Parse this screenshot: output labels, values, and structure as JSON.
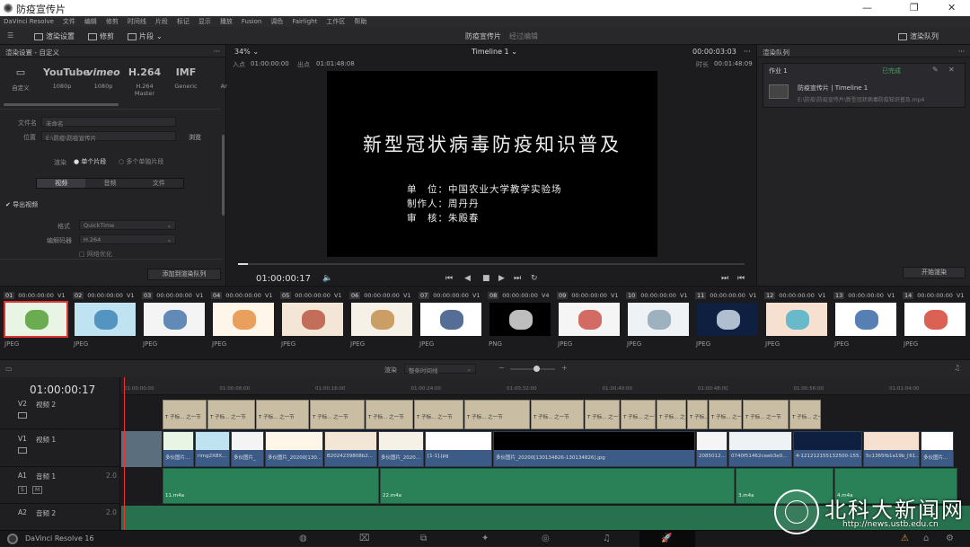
{
  "window": {
    "title": "防疫宣传片"
  },
  "menu": [
    "DaVinci Resolve",
    "文件",
    "编辑",
    "修剪",
    "时间线",
    "片段",
    "标记",
    "显示",
    "播放",
    "Fusion",
    "调色",
    "Fairlight",
    "工作区",
    "帮助"
  ],
  "toolbar": {
    "render_settings": "渲染设置",
    "clip": "修剪",
    "clip_sub": "片段",
    "project_name": "防疫宣传片",
    "edited": "经过编辑",
    "render_queue": "渲染队列"
  },
  "left_panel": {
    "title": "渲染设置 - 自定义",
    "presets": [
      {
        "big": "▭",
        "label": "自定义"
      },
      {
        "big": "YouTube",
        "label": "1080p"
      },
      {
        "big": "vimeo",
        "label": "1080p"
      },
      {
        "big": "H.264",
        "label": "H.264 Master"
      },
      {
        "big": "IMF",
        "label": "Generic"
      },
      {
        "big": "",
        "label": "Ame"
      }
    ],
    "filename_label": "文件名",
    "filename_value": "未命名",
    "location_label": "位置",
    "location_value": "E:\\防疫\\防疫宣传片",
    "browse": "浏览",
    "render_label": "渲染",
    "single_clip": "单个片段",
    "multi_clip": "多个单独片段",
    "tabs": [
      "视频",
      "音频",
      "文件"
    ],
    "export_video": "导出视频",
    "format_label": "格式",
    "format_value": "QuickTime",
    "codec_label": "编解码器",
    "codec_value": "H.264",
    "net_opt": "网络优化",
    "add_queue": "添加到渲染队列"
  },
  "viewer": {
    "zoom": "34%",
    "timeline_name": "Timeline 1",
    "tc_right": "00:00:03:03",
    "in_label": "入点",
    "in_tc": "01:00:00:00",
    "out_label": "出点",
    "out_tc": "01:01:48:08",
    "dur_label": "时长",
    "dur_tc": "00:01:48:09",
    "title": "新型冠状病毒防疫知识普及",
    "credits": [
      {
        "k": "单　位：",
        "v": "中国农业大学教学实验场"
      },
      {
        "k": "制作人：",
        "v": "周丹丹"
      },
      {
        "k": "审　核：",
        "v": "朱殿春"
      }
    ],
    "timecode": "01:00:00:17",
    "play_progress": 0.02
  },
  "right_panel": {
    "title": "渲染队列",
    "job": "作业 1",
    "job_status": "已完成",
    "job_title": "防疫宣传片 | Timeline 1",
    "job_path": "E:\\防疫\\防疫宣传片\\新型冠状病毒防疫知识普及.mp4",
    "start_render": "开始渲染"
  },
  "media_strip": [
    {
      "n": "01",
      "tc": "00:00:00:00",
      "v": "V1",
      "fmt": "JPEG",
      "color": "#e9f5e4",
      "accent": "#4c9a2a"
    },
    {
      "n": "02",
      "tc": "00:00:00:00",
      "v": "V1",
      "fmt": "JPEG",
      "color": "#bfe3f0",
      "accent": "#3a7fb4"
    },
    {
      "n": "03",
      "tc": "00:00:00:00",
      "v": "V1",
      "fmt": "JPEG",
      "color": "#f4f4f4",
      "accent": "#3c6fa6"
    },
    {
      "n": "04",
      "tc": "00:00:00:00",
      "v": "V1",
      "fmt": "JPEG",
      "color": "#fdf6e9",
      "accent": "#e38b3a"
    },
    {
      "n": "05",
      "tc": "00:00:00:00",
      "v": "V1",
      "fmt": "JPEG",
      "color": "#f3e6d6",
      "accent": "#b5503c"
    },
    {
      "n": "06",
      "tc": "00:00:00:00",
      "v": "V1",
      "fmt": "JPEG",
      "color": "#f6f1e6",
      "accent": "#c08a45"
    },
    {
      "n": "07",
      "tc": "00:00:00:00",
      "v": "V1",
      "fmt": "JPEG",
      "color": "#ffffff",
      "accent": "#2a4a7a"
    },
    {
      "n": "08",
      "tc": "00:00:00:00",
      "v": "V4",
      "fmt": "PNG",
      "color": "#000000",
      "accent": "#eeeeee"
    },
    {
      "n": "09",
      "tc": "00:00:00:00",
      "v": "V1",
      "fmt": "JPEG",
      "color": "#f5f5f5",
      "accent": "#c9493f"
    },
    {
      "n": "10",
      "tc": "00:00:00:00",
      "v": "V1",
      "fmt": "JPEG",
      "color": "#eef2f5",
      "accent": "#8aa0b0"
    },
    {
      "n": "11",
      "tc": "00:00:00:00",
      "v": "V1",
      "fmt": "JPEG",
      "color": "#0f1f3f",
      "accent": "#d8e6f5"
    },
    {
      "n": "12",
      "tc": "00:00:00:00",
      "v": "V1",
      "fmt": "JPEG",
      "color": "#f7e0cf",
      "accent": "#44b0c8"
    },
    {
      "n": "13",
      "tc": "00:00:00:00",
      "v": "V1",
      "fmt": "JPEG",
      "color": "#ffffff",
      "accent": "#2e5fa0"
    },
    {
      "n": "14",
      "tc": "00:00:00:00",
      "v": "V1",
      "fmt": "JPEG",
      "color": "#ffffff",
      "accent": "#d33a2a"
    }
  ],
  "timeline": {
    "mode_label": "渲染",
    "mode_value": "整条时间线",
    "timecode": "01:00:00:17",
    "ruler": [
      "01:00:00:00",
      "01:00:08:00",
      "01:00:16:00",
      "01:00:24:00",
      "01:00:32:00",
      "01:00:40:00",
      "01:00:48:00",
      "01:00:56:00",
      "01:01:04:00"
    ],
    "tracks": {
      "v2": "视频 2",
      "v1": "视频 1",
      "a1": "音频 1",
      "a2": "音频 2",
      "a_level": "2.0"
    },
    "v1_clips": [
      "多伙图片...",
      "rimg2X8X...",
      "多伙图片_",
      "多伙图片_20200[130...",
      "B2024239808b2...",
      "多伙图片_2020...",
      "[1-1].jpg",
      "多伙图片_20200[130134826-130134826].jpg",
      "2085012...",
      "0740f51462ceeb3e0...",
      "4-121212155132500-155...",
      "5c1365fb1a19b_[61...",
      "多伙图片..."
    ],
    "v2_label": "T 子标... 之一节",
    "a1_clips": [
      "11.m4a",
      "22.m4a",
      "3.m4a",
      "4.m4a"
    ]
  },
  "statusbar": {
    "app": "DaVinci Resolve 16"
  },
  "watermark": {
    "text": "北科大新闻网",
    "url": "http://news.ustb.edu.cn"
  }
}
